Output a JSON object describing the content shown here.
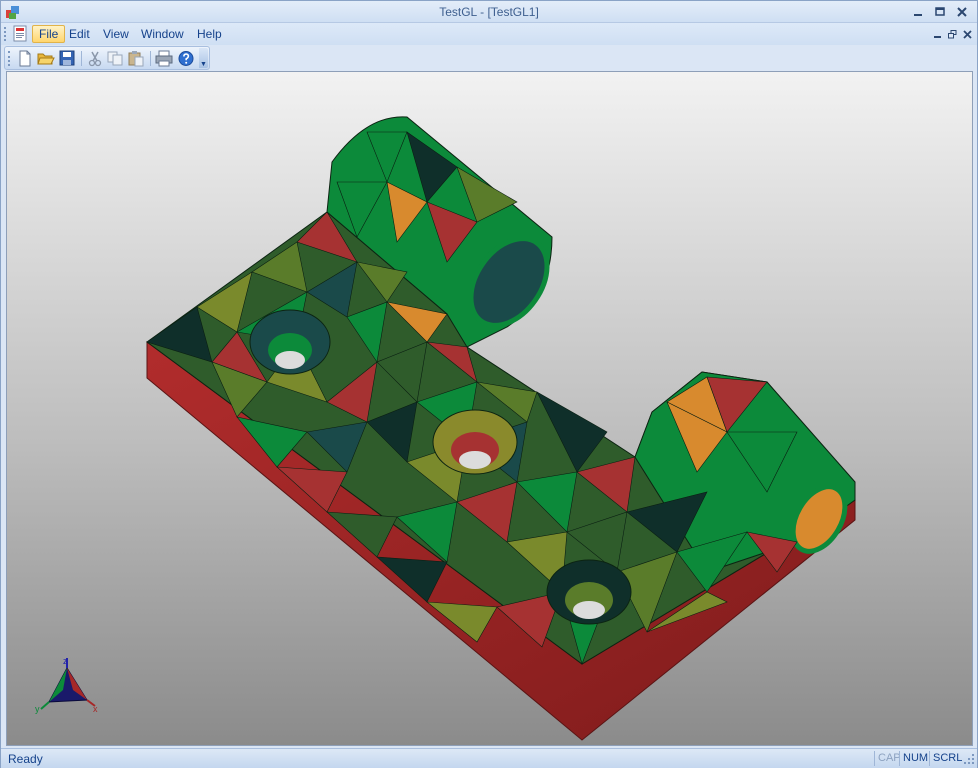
{
  "window": {
    "title": "TestGL - [TestGL1]"
  },
  "menu": {
    "items": [
      {
        "label": "File",
        "active": true
      },
      {
        "label": "Edit"
      },
      {
        "label": "View"
      },
      {
        "label": "Window"
      },
      {
        "label": "Help"
      }
    ]
  },
  "toolbar": {
    "buttons": [
      {
        "icon": "new-document-icon"
      },
      {
        "icon": "open-folder-icon"
      },
      {
        "icon": "save-icon"
      },
      {
        "icon": "cut-icon"
      },
      {
        "icon": "copy-icon"
      },
      {
        "icon": "paste-icon"
      },
      {
        "icon": "print-icon"
      },
      {
        "icon": "help-icon"
      }
    ]
  },
  "viewport": {
    "background_top": "#f2f2f2",
    "background_bottom": "#8b8b8b",
    "mesh_colors": [
      "#0c8a3a",
      "#2f5c2b",
      "#7a8a2c",
      "#a63232",
      "#1a4a4a",
      "#d88a2e",
      "#5a7c2a",
      "#0f2f2a"
    ],
    "side_color": "#a62828",
    "axis_labels": {
      "x": "x",
      "y": "y",
      "z": "z"
    }
  },
  "statusbar": {
    "text": "Ready",
    "indicators": [
      {
        "label": "CAP",
        "active": false
      },
      {
        "label": "NUM",
        "active": true
      },
      {
        "label": "SCRL",
        "active": true
      }
    ]
  }
}
